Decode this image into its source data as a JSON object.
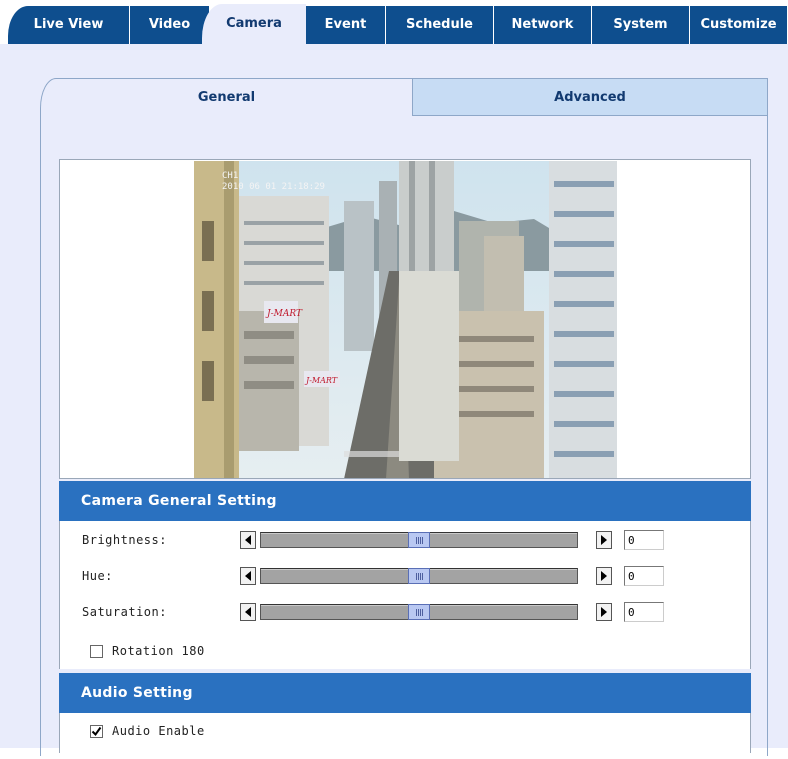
{
  "top_tabs": [
    {
      "label": "Live View"
    },
    {
      "label": "Video"
    },
    {
      "label": "Camera",
      "active": true
    },
    {
      "label": "Event"
    },
    {
      "label": "Schedule"
    },
    {
      "label": "Network"
    },
    {
      "label": "System"
    },
    {
      "label": "Customize"
    }
  ],
  "sub_tabs": {
    "general": "General",
    "advanced": "Advanced"
  },
  "preview": {
    "overlay_text_line1": "CH1",
    "overlay_text_line2": "2010 06 01   21:18:29",
    "sign1": "J-MART",
    "sign2": "J-MART"
  },
  "camera_section": {
    "title": "Camera General Setting",
    "brightness": {
      "label": "Brightness:",
      "value": "0",
      "slider_fraction": 0.5
    },
    "hue": {
      "label": "Hue:",
      "value": "0",
      "slider_fraction": 0.5
    },
    "saturation": {
      "label": "Saturation:",
      "value": "0",
      "slider_fraction": 0.5
    },
    "rotation": {
      "label": "Rotation 180",
      "checked": false
    }
  },
  "audio_section": {
    "title": "Audio Setting",
    "audio_enable": {
      "label": "Audio Enable",
      "checked": true
    }
  },
  "colors": {
    "tab_blue": "#0e4e8e",
    "section_blue": "#2a71c0",
    "panel_bg": "#e9ecfb",
    "advanced_tab": "#c7dcf4"
  }
}
